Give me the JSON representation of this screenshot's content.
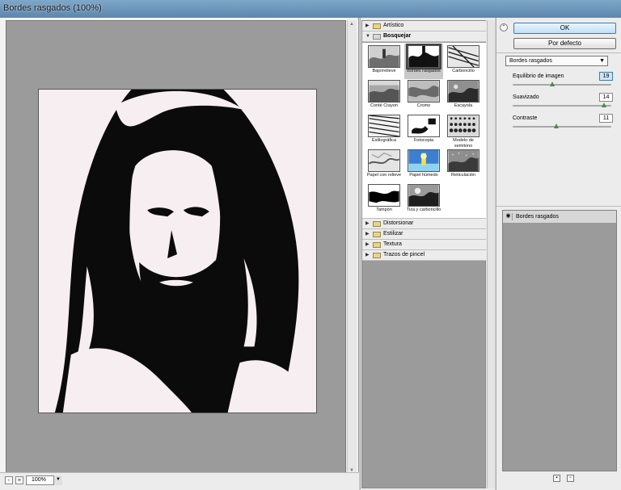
{
  "window": {
    "title": "Bordes rasgados (100%)"
  },
  "zoom": {
    "minus": "-",
    "plus": "+",
    "value": "100%"
  },
  "gallery": {
    "categories_top": [
      {
        "label": "Artístico",
        "open": false
      }
    ],
    "open_category": {
      "label": "Bosquejar"
    },
    "filters": [
      {
        "label": "Bajorrelieve"
      },
      {
        "label": "Bordes rasgados"
      },
      {
        "label": "Carboncillo"
      },
      {
        "label": "Conté Crayon"
      },
      {
        "label": "Cromo"
      },
      {
        "label": "Escayola"
      },
      {
        "label": "Estilográfica"
      },
      {
        "label": "Fotocopia"
      },
      {
        "label": "Modelo de semitono"
      },
      {
        "label": "Papel con relieve"
      },
      {
        "label": "Papel húmedo"
      },
      {
        "label": "Reticulación"
      },
      {
        "label": "Tampón"
      },
      {
        "label": "Tiza y carboncillo"
      }
    ],
    "selected_filter": "Bordes rasgados",
    "categories_bottom": [
      {
        "label": "Distorsionar"
      },
      {
        "label": "Estilizar"
      },
      {
        "label": "Textura"
      },
      {
        "label": "Trazos de pincel"
      }
    ]
  },
  "settings": {
    "ok": "OK",
    "default": "Por defecto",
    "filter_select": "Bordes rasgados",
    "params": [
      {
        "label": "Equilibrio de imagen",
        "value": "19",
        "fraction": 0.4
      },
      {
        "label": "Suavizado",
        "value": "14",
        "fraction": 0.93
      },
      {
        "label": "Contraste",
        "value": "11",
        "fraction": 0.44
      }
    ],
    "layer": {
      "label": "Bordes rasgados"
    }
  }
}
